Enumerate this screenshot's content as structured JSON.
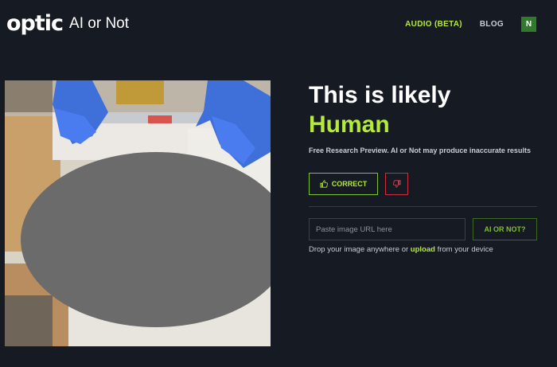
{
  "header": {
    "logo_text": "optic",
    "product_name": "AI or Not",
    "nav": {
      "audio_label": "AUDIO (BETA)",
      "blog_label": "BLOG"
    },
    "avatar_initial": "N"
  },
  "result": {
    "headline": "This is likely",
    "verdict": "Human",
    "disclaimer": "Free Research Preview. AI or Not may produce inaccurate results",
    "correct_label": "CORRECT"
  },
  "url_check": {
    "placeholder": "Paste image URL here",
    "button_label": "AI OR NOT?"
  },
  "drop": {
    "prefix": "Drop your image anywhere or",
    "upload_label": "upload",
    "suffix": "from your device"
  },
  "colors": {
    "accent": "#b5ea3a",
    "background": "#161a22",
    "danger": "#c43040",
    "avatar_bg": "#2f7a2b"
  }
}
